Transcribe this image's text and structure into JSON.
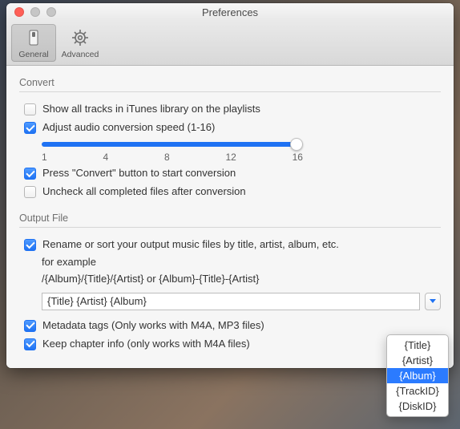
{
  "window": {
    "title": "Preferences"
  },
  "toolbar": {
    "general": "General",
    "advanced": "Advanced"
  },
  "convert": {
    "heading": "Convert",
    "show_all": "Show all tracks in iTunes library on the playlists",
    "adjust_speed": "Adjust audio conversion speed (1-16)",
    "ticks": {
      "t1": "1",
      "t2": "4",
      "t3": "8",
      "t4": "12",
      "t5": "16"
    },
    "press_convert": "Press \"Convert\" button to start conversion",
    "uncheck_completed": "Uncheck all completed files after conversion"
  },
  "output": {
    "heading": "Output File",
    "rename": "Rename or sort your output music files by title, artist, album, etc.",
    "example_line1": "for example",
    "example_line2": "/{Album}/{Title}/{Artist} or {Album}-{Title}-{Artist}",
    "filename_value": "{Title} {Artist} {Album}",
    "metadata": "Metadata tags (Only works with M4A, MP3 files)",
    "chapter": "Keep chapter info (only works with  M4A files)"
  },
  "menu": {
    "items": {
      "i0": "{Title}",
      "i1": "{Artist}",
      "i2": "{Album}",
      "i3": "{TrackID}",
      "i4": "{DiskID}"
    }
  }
}
